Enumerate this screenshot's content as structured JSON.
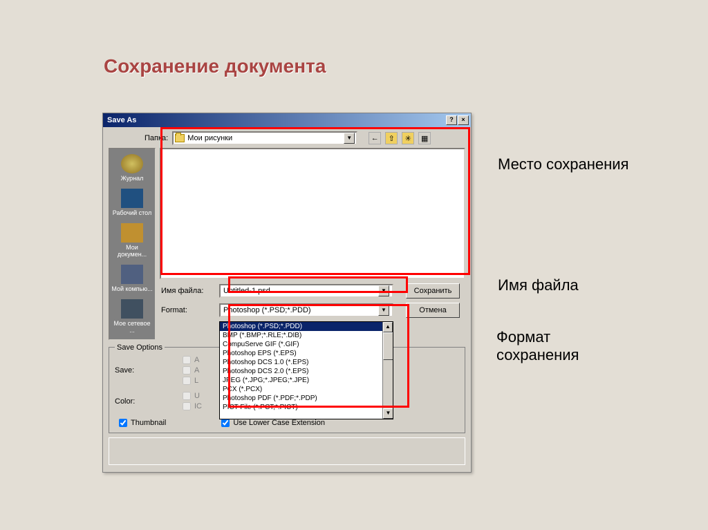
{
  "slide": {
    "title": "Сохранение документа"
  },
  "dialog": {
    "title": "Save As",
    "folder_label": "Папка:",
    "folder_value": "Мои рисунки",
    "filename_label": "Имя файла:",
    "filename_value": "Untitled-1.psd",
    "format_label": "Format:",
    "format_value": "Photoshop (*.PSD;*.PDD)",
    "save_btn": "Сохранить",
    "cancel_btn": "Отмена",
    "save_options_label": "Save Options",
    "save_label": "Save:",
    "color_label": "Color:",
    "checkbox_thumbnail": "Thumbnail",
    "checkbox_lowercase": "Use Lower Case Extension"
  },
  "sidebar": {
    "items": [
      {
        "label": "Журнал"
      },
      {
        "label": "Рабочий стол"
      },
      {
        "label": "Мои докумен..."
      },
      {
        "label": "Мой компью..."
      },
      {
        "label": "Мое сетевое ..."
      }
    ]
  },
  "format_options": [
    "Photoshop (*.PSD;*.PDD)",
    "BMP (*.BMP;*.RLE;*.DIB)",
    "CompuServe GIF (*.GIF)",
    "Photoshop EPS (*.EPS)",
    "Photoshop DCS 1.0 (*.EPS)",
    "Photoshop DCS 2.0 (*.EPS)",
    "JPEG (*.JPG;*.JPEG;*.JPE)",
    "PCX (*.PCX)",
    "Photoshop PDF (*.PDF;*.PDP)",
    "PICT File (*.PCT;*.PICT)"
  ],
  "annotations": {
    "location": "Место сохранения",
    "filename": "Имя файла",
    "format": "Формат сохранения"
  }
}
